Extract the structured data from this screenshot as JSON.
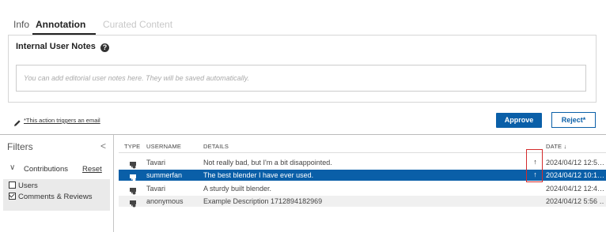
{
  "tabs": [
    {
      "label": "Info"
    },
    {
      "label": "Annotation"
    },
    {
      "label": "Curated Content"
    }
  ],
  "notes": {
    "title": "Internal User Notes",
    "help_glyph": "?",
    "placeholder": "You can add editorial user notes here. They will be saved automatically."
  },
  "actions": {
    "email_notice": "*This action triggers an email",
    "approve_label": "Approve",
    "reject_label": "Reject*"
  },
  "filters": {
    "title": "Filters",
    "collapse_glyph": "<",
    "group_chevron": "∨",
    "group_label": "Contributions",
    "reset_label": "Reset",
    "options": [
      {
        "label": "Users",
        "checked": false
      },
      {
        "label": "Comments & Reviews",
        "checked": true
      }
    ]
  },
  "table": {
    "headers": {
      "type": "TYPE",
      "username": "USERNAME",
      "details": "DETAILS",
      "date": "DATE ↓"
    },
    "rows": [
      {
        "type_icon": "comment-icon",
        "username": "Tavari",
        "details": "Not really bad, but I'm a bit disappointed.",
        "arrow": "↑",
        "date": "2024/04/12 12:5…",
        "selected": false
      },
      {
        "type_icon": "comment-icon",
        "username": "summerfan",
        "details": "The best blender I have ever used.",
        "arrow": "↑",
        "date": "2024/04/12 10:1…",
        "selected": true
      },
      {
        "type_icon": "comment-icon",
        "username": "Tavari",
        "details": "A sturdy built blender.",
        "arrow": "",
        "date": "2024/04/12 12:4…",
        "selected": false
      },
      {
        "type_icon": "comment-icon",
        "username": "anonymous",
        "details": "Example Description 1712894182969",
        "arrow": "",
        "date": "2024/04/12 5:56 …",
        "selected": false
      }
    ]
  },
  "colors": {
    "accent": "#0a5fa8",
    "highlight": "#d42b2b"
  }
}
